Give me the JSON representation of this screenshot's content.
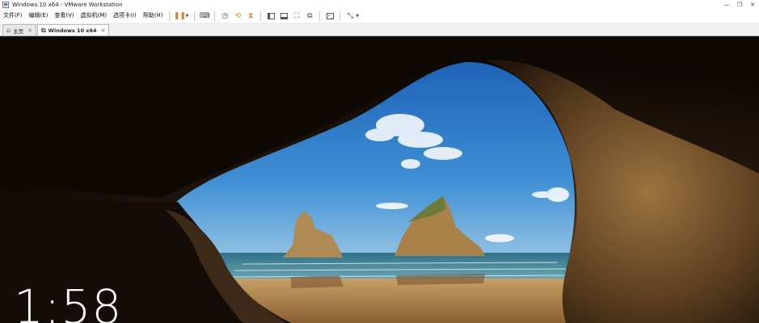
{
  "window": {
    "title": "Windows 10 x64 - VMware Workstation"
  },
  "menu": {
    "items": [
      "文件(F)",
      "编辑(E)",
      "查看(V)",
      "虚拟机(M)",
      "选项卡(I)",
      "帮助(H)"
    ]
  },
  "toolbar": {
    "icons": [
      "pause-icon",
      "send-ctrl-alt-del-icon",
      "snapshot-icon",
      "revert-snapshot-icon",
      "manage-snapshots-icon",
      "show-library-icon",
      "thumbnail-icon",
      "full-screen-icon",
      "unity-icon",
      "console-icon",
      "stretch-icon"
    ]
  },
  "tabs": [
    {
      "label": "主页",
      "icon": "home-icon"
    },
    {
      "label": "Windows 10 x64",
      "icon": "vm-icon",
      "active": true
    }
  ],
  "lockscreen": {
    "time": "1:58"
  },
  "colors": {
    "pause_accent": "#e27a1d",
    "sky": "#2f78c8",
    "sea": "#3f8aa0",
    "sand": "#b98a52",
    "cave_rock": "#3a2616"
  }
}
